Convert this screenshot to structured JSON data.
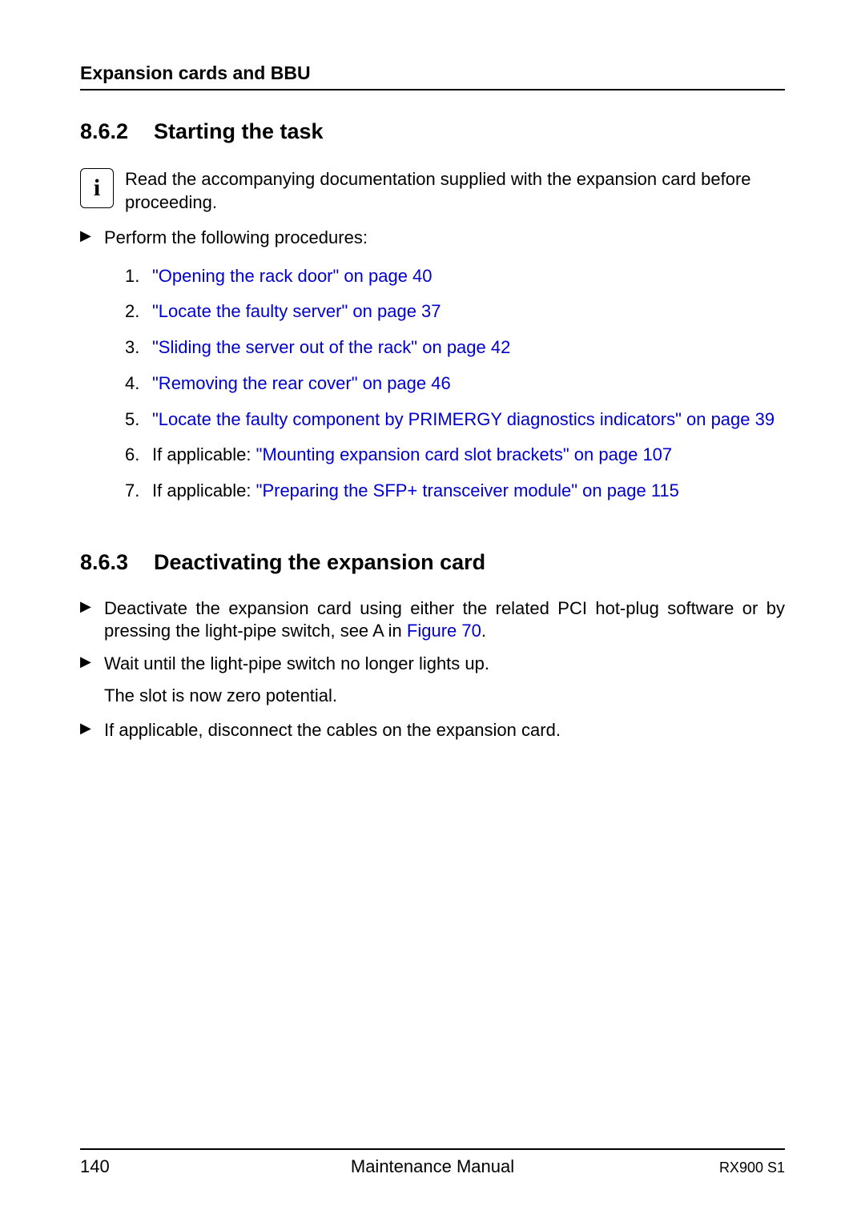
{
  "header": {
    "title": "Expansion cards and BBU"
  },
  "section1": {
    "number": "8.6.2",
    "title": "Starting the task",
    "info_text": "Read the accompanying documentation supplied with the expansion card before proceeding.",
    "bullet_intro": "Perform the following procedures:",
    "procs": [
      {
        "n": "1.",
        "prefix": "",
        "link": "\"Opening the rack door\" on page 40",
        "suffix": ""
      },
      {
        "n": "2.",
        "prefix": "",
        "link": "\"Locate the faulty server\" on page 37",
        "suffix": ""
      },
      {
        "n": "3.",
        "prefix": "",
        "link": "\"Sliding the server out of the rack\" on page 42",
        "suffix": ""
      },
      {
        "n": "4.",
        "prefix": "",
        "link": "\"Removing the rear cover\" on page 46",
        "suffix": ""
      },
      {
        "n": "5.",
        "prefix": "",
        "link": "\"Locate the faulty component by PRIMERGY diagnostics indicators\" on page 39",
        "suffix": ""
      },
      {
        "n": "6.",
        "prefix": "If applicable: ",
        "link": "\"Mounting expansion card slot brackets\" on page 107",
        "suffix": ""
      },
      {
        "n": "7.",
        "prefix": "If applicable: ",
        "link": "\"Preparing the SFP+ transceiver module\" on page 115",
        "suffix": ""
      }
    ]
  },
  "section2": {
    "number": "8.6.3",
    "title": "Deactivating the expansion card",
    "b1_pre": "Deactivate the expansion card using either the related PCI hot-plug software or by pressing the light-pipe switch, see A in ",
    "b1_link": "Figure 70",
    "b1_post": ".",
    "b2": "Wait until the light-pipe switch no longer lights up.",
    "b2_sub": "The slot is now zero potential.",
    "b3": "If applicable, disconnect the cables on the expansion card."
  },
  "footer": {
    "page": "140",
    "center": "Maintenance Manual",
    "right": "RX900 S1"
  }
}
